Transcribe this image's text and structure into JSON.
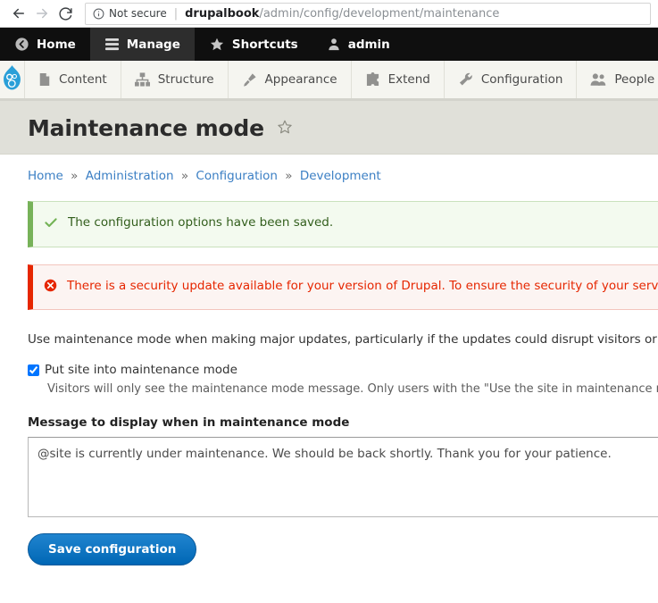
{
  "browser": {
    "back_icon": "back-arrow-icon",
    "forward_icon": "forward-arrow-icon",
    "reload_icon": "reload-icon",
    "security_icon": "info-circle-icon",
    "security_label": "Not secure",
    "separator": "|",
    "url_host": "drupalbook",
    "url_path": "/admin/config/development/maintenance"
  },
  "admin_toolbar": {
    "items": [
      {
        "label": "Home",
        "icon": "back-circle-icon",
        "active": false
      },
      {
        "label": "Manage",
        "icon": "hamburger-icon",
        "active": true
      },
      {
        "label": "Shortcuts",
        "icon": "star-icon",
        "active": false
      },
      {
        "label": "admin",
        "icon": "user-icon",
        "active": false
      }
    ]
  },
  "admin_menu": {
    "logo_icon": "drupal-droplet-icon",
    "items": [
      {
        "label": "Content",
        "icon": "file-icon"
      },
      {
        "label": "Structure",
        "icon": "sitemap-icon"
      },
      {
        "label": "Appearance",
        "icon": "paintbrush-icon"
      },
      {
        "label": "Extend",
        "icon": "puzzle-icon"
      },
      {
        "label": "Configuration",
        "icon": "wrench-icon"
      },
      {
        "label": "People",
        "icon": "people-icon"
      }
    ]
  },
  "page": {
    "title": "Maintenance mode",
    "favorite_icon": "star-outline-icon"
  },
  "breadcrumb": {
    "separator": "»",
    "items": [
      "Home",
      "Administration",
      "Configuration",
      "Development"
    ]
  },
  "messages": {
    "status": {
      "icon": "checkmark-icon",
      "text": "The configuration options have been saved."
    },
    "error": {
      "icon": "error-circle-icon",
      "text": "There is a security update available for your version of Drupal. To ensure the security of your server, y"
    }
  },
  "form": {
    "intro": "Use maintenance mode when making major updates, particularly if the updates could disrupt visitors or the",
    "checkbox_label": "Put site into maintenance mode",
    "checkbox_checked": true,
    "checkbox_description": "Visitors will only see the maintenance mode message. Only users with the \"Use the site in maintenance mode\"",
    "textarea_label": "Message to display when in maintenance mode",
    "textarea_value": "@site is currently under maintenance. We should be back shortly. Thank you for your patience.",
    "save_label": "Save configuration"
  },
  "colors": {
    "toolbar_bg": "#0f0f0f",
    "menu_bg": "#f5f5f0",
    "title_band_bg": "#e0e0d9",
    "link_blue": "#3b7fc4",
    "drupal_blue": "#2a9fd8",
    "status_green": "#77b259",
    "error_red": "#e62600",
    "button_blue": "#0b72c4"
  }
}
